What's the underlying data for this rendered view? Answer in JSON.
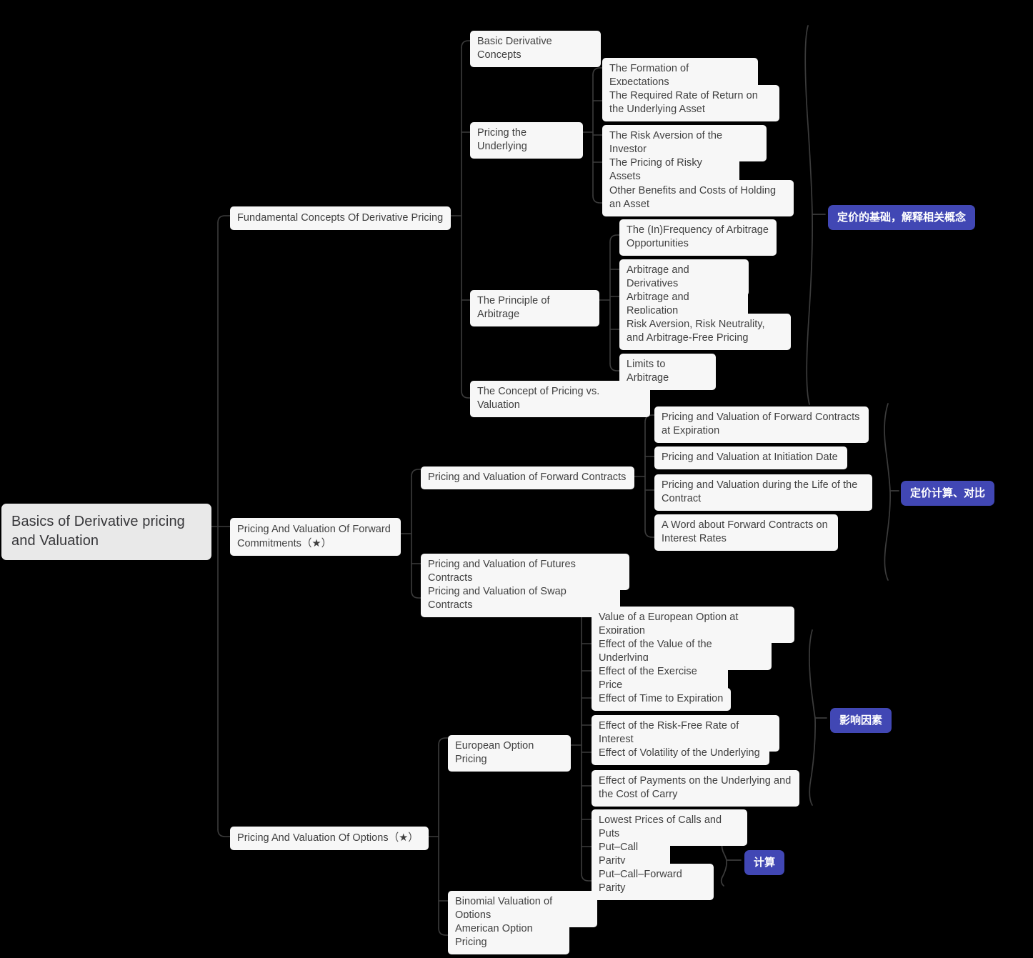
{
  "mindmap": {
    "root": {
      "label": "Basics of Derivative pricing and Valuation"
    },
    "branches": [
      {
        "label": "Fundamental Concepts Of Derivative Pricing",
        "children": [
          {
            "label": "Basic Derivative Concepts",
            "children": []
          },
          {
            "label": "Pricing the Underlying",
            "children": [
              {
                "label": "The Formation of Expectations"
              },
              {
                "label": "The Required Rate of Return on the Underlying Asset"
              },
              {
                "label": "The Risk Aversion of the Investor"
              },
              {
                "label": "The Pricing of Risky Assets"
              },
              {
                "label": "Other Benefits and Costs of Holding an Asset"
              }
            ]
          },
          {
            "label": "The Principle of Arbitrage",
            "children": [
              {
                "label": "The (In)Frequency of Arbitrage Opportunities"
              },
              {
                "label": "Arbitrage and Derivatives"
              },
              {
                "label": "Arbitrage and Replication"
              },
              {
                "label": "Risk Aversion, Risk Neutrality, and Arbitrage-Free Pricing"
              },
              {
                "label": "Limits to Arbitrage"
              }
            ]
          },
          {
            "label": "The Concept of Pricing vs. Valuation",
            "children": []
          }
        ]
      },
      {
        "label": "Pricing And Valuation Of Forward Commitments（★）",
        "children": [
          {
            "label": "Pricing and Valuation of Forward Contracts",
            "children": [
              {
                "label": "Pricing and Valuation of Forward Contracts at Expiration"
              },
              {
                "label": "Pricing and Valuation at Initiation Date"
              },
              {
                "label": "Pricing and Valuation during the Life of the Contract"
              },
              {
                "label": "A Word about Forward Contracts on Interest Rates"
              }
            ]
          },
          {
            "label": "Pricing and Valuation of Futures Contracts",
            "children": []
          },
          {
            "label": "Pricing and Valuation of Swap Contracts",
            "children": []
          }
        ]
      },
      {
        "label": "Pricing And Valuation Of Options（★）",
        "children": [
          {
            "label": "European Option Pricing",
            "children": [
              {
                "label": "Value of a European Option at Expiration"
              },
              {
                "label": "Effect of the Value of the Underlying"
              },
              {
                "label": "Effect of the Exercise Price"
              },
              {
                "label": "Effect of Time to Expiration"
              },
              {
                "label": "Effect of the Risk-Free Rate of Interest"
              },
              {
                "label": "Effect of Volatility of the Underlying"
              },
              {
                "label": "Effect of Payments on the Underlying and the Cost of Carry"
              },
              {
                "label": "Lowest Prices of Calls and Puts"
              },
              {
                "label": "Put–Call Parity"
              },
              {
                "label": "Put–Call–Forward Parity"
              }
            ]
          },
          {
            "label": "Binomial Valuation of Options",
            "children": []
          },
          {
            "label": "American Option Pricing",
            "children": []
          }
        ]
      }
    ],
    "annotations": [
      {
        "label": "定价的基础，解释相关概念"
      },
      {
        "label": "定价计算、对比"
      },
      {
        "label": "影响因素"
      },
      {
        "label": "计算"
      }
    ],
    "colors": {
      "background": "#000000",
      "node_bg": "#f7f7f7",
      "node_text": "#3f3f3f",
      "root_bg": "#e9e9e9",
      "badge_bg": "#4147b4",
      "badge_text": "#ffffff",
      "edge": "#3a3a3a"
    }
  }
}
